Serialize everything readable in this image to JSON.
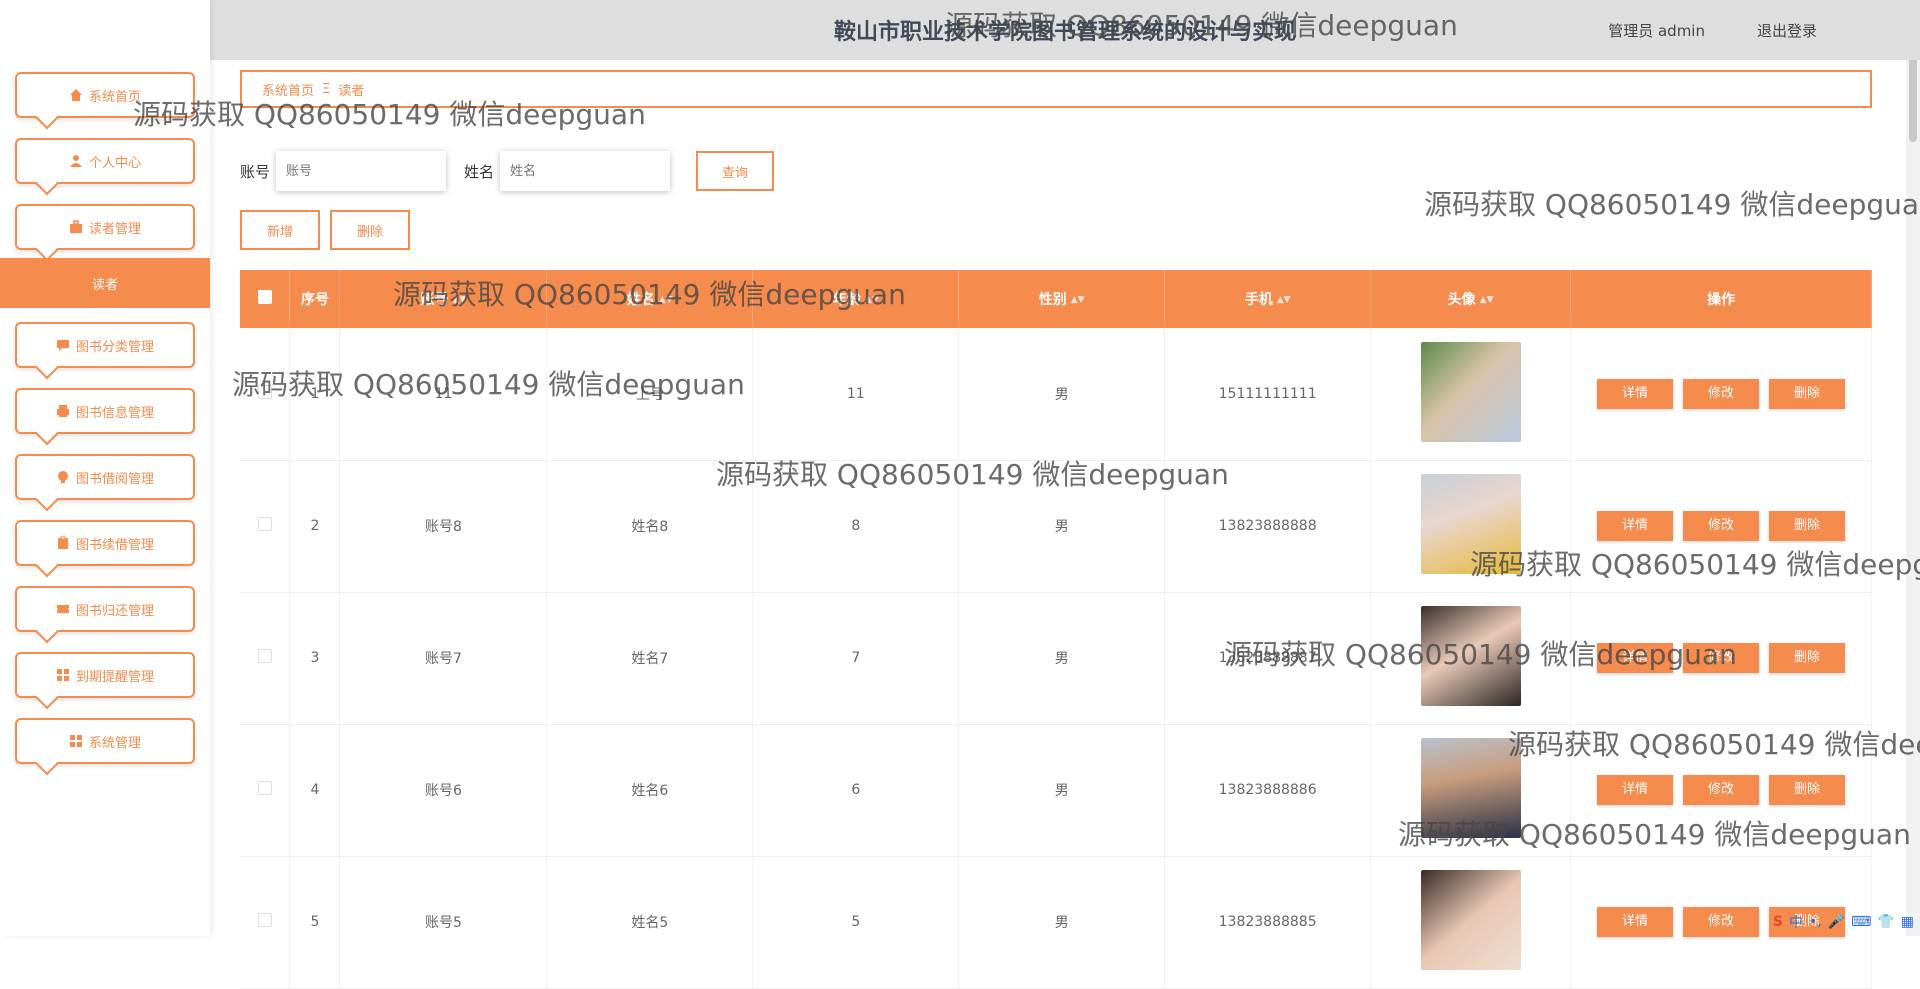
{
  "header": {
    "title": "鞍山市职业技术学院图书管理系统的设计与实现",
    "user": "管理员 admin",
    "logout": "退出登录"
  },
  "sidebar": {
    "items": [
      {
        "label": "系统首页",
        "icon": "home-icon"
      },
      {
        "label": "个人中心",
        "icon": "user-icon"
      },
      {
        "label": "读者管理",
        "icon": "briefcase-icon"
      },
      {
        "label": "图书分类管理",
        "icon": "chat-icon"
      },
      {
        "label": "图书信息管理",
        "icon": "printer-icon"
      },
      {
        "label": "图书借阅管理",
        "icon": "bulb-icon"
      },
      {
        "label": "图书续借管理",
        "icon": "clipboard-icon"
      },
      {
        "label": "图书归还管理",
        "icon": "ticket-icon"
      },
      {
        "label": "到期提醒管理",
        "icon": "grid-icon"
      },
      {
        "label": "系统管理",
        "icon": "grid-icon"
      }
    ],
    "active_sub": "读者"
  },
  "breadcrumb": {
    "home": "系统首页",
    "sep": "Ξ",
    "current": "读者"
  },
  "search": {
    "account_label": "账号",
    "account_placeholder": "账号",
    "name_label": "姓名",
    "name_placeholder": "姓名",
    "button": "查询"
  },
  "actions": {
    "add": "新增",
    "delete": "删除"
  },
  "table": {
    "headers": [
      "序号",
      "账号",
      "姓名",
      "年龄",
      "性别",
      "手机",
      "头像",
      "操作"
    ],
    "rows": [
      {
        "index": "1",
        "account": "11",
        "name": "上号",
        "age": "11",
        "gender": "男",
        "phone": "15111111111"
      },
      {
        "index": "2",
        "account": "账号8",
        "name": "姓名8",
        "age": "8",
        "gender": "男",
        "phone": "13823888888"
      },
      {
        "index": "3",
        "account": "账号7",
        "name": "姓名7",
        "age": "7",
        "gender": "男",
        "phone": "13823888887"
      },
      {
        "index": "4",
        "account": "账号6",
        "name": "姓名6",
        "age": "6",
        "gender": "男",
        "phone": "13823888886"
      },
      {
        "index": "5",
        "account": "账号5",
        "name": "姓名5",
        "age": "5",
        "gender": "男",
        "phone": "13823888885"
      }
    ],
    "op_detail": "详情",
    "op_edit": "修改",
    "op_delete": "删除"
  },
  "watermark": "源码获取 QQ86050149 微信deepguan",
  "colors": {
    "accent": "#f58b4c",
    "header_bg": "#dedede"
  }
}
